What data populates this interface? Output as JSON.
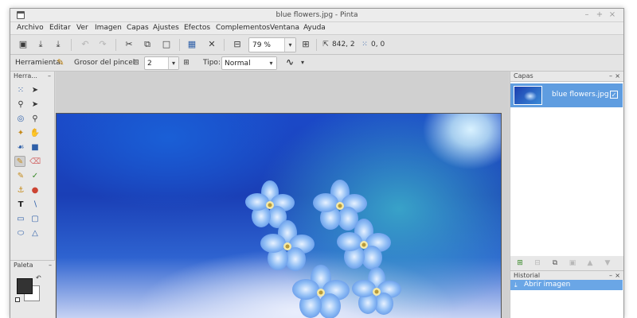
{
  "window": {
    "title": "blue flowers.jpg - Pinta",
    "controls": {
      "minimize": "–",
      "maximize": "+",
      "close": "×"
    }
  },
  "menubar": {
    "items": [
      "Archivo",
      "Editar",
      "Ver",
      "Imagen",
      "Capas",
      "Ajustes",
      "Efectos",
      "Complementos",
      "Ventana",
      "Ayuda"
    ]
  },
  "toolbar": {
    "zoom_value": "79 %",
    "zoom_dropdown": "▾",
    "cursor_position": "842, 2",
    "selection_size": "0, 0",
    "icons": {
      "new": "new-document-icon",
      "open": "open-icon",
      "save": "save-icon",
      "undo": "undo-icon",
      "redo": "redo-icon",
      "cut": "cut-icon",
      "copy": "copy-icon",
      "paste": "paste-icon",
      "crop": "crop-to-selection-icon",
      "deselect": "deselect-icon",
      "zoom_out": "zoom-out-icon",
      "zoom_in": "zoom-in-icon"
    }
  },
  "options": {
    "tool_label": "Herramienta:",
    "brush_width_label": "Grosor del pincel:",
    "brush_width_value": "2",
    "type_label": "Tipo:",
    "type_value": "Normal"
  },
  "tools_panel": {
    "title": "Herra...",
    "pin": "–"
  },
  "palette_panel": {
    "title": "Paleta",
    "pin": "–",
    "primary_color": "#333333",
    "secondary_color": "#ffffff"
  },
  "layers_panel": {
    "title": "Capas",
    "pin": "–",
    "close": "×",
    "layers": [
      {
        "name": "blue flowers.jpg",
        "visible": true,
        "check": "✓"
      }
    ]
  },
  "history_panel": {
    "title": "Historial",
    "pin": "–",
    "close": "×",
    "items": [
      {
        "label": "Abrir imagen"
      }
    ]
  },
  "colors": {
    "selection_blue": "#5f9de0",
    "canvas_bg": "#d0d0d0"
  }
}
